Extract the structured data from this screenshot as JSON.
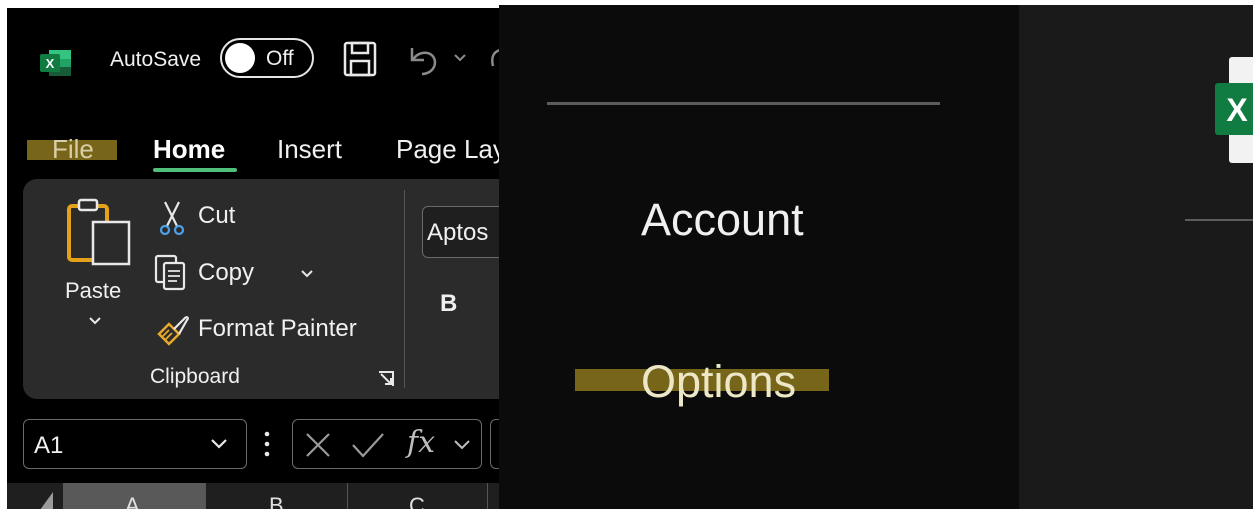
{
  "titlebar": {
    "autosave_label": "AutoSave",
    "autosave_state": "Off",
    "app_badge": "X"
  },
  "tabs": [
    "File",
    "Home",
    "Insert",
    "Page Lay"
  ],
  "clipboard": {
    "paste": "Paste",
    "cut": "Cut",
    "copy": "Copy",
    "format_painter": "Format Painter",
    "group_label": "Clipboard"
  },
  "font": {
    "name": "Aptos",
    "bold": "B"
  },
  "formula_bar": {
    "name_box": "A1",
    "fx": "fx"
  },
  "columns": [
    "A",
    "B",
    "C"
  ],
  "backstage": {
    "account": "Account",
    "options": "Options"
  },
  "colors": {
    "highlight": "#7d6a1b",
    "excel_green": "#107c41",
    "home_underline": "#4fbf7a"
  },
  "icons": [
    "excel-logo-icon",
    "save-icon",
    "undo-icon",
    "paste-icon",
    "scissors-icon",
    "copy-icon",
    "paintbrush-icon",
    "dialog-launcher-icon",
    "cancel-icon",
    "check-icon",
    "fx-icon"
  ]
}
